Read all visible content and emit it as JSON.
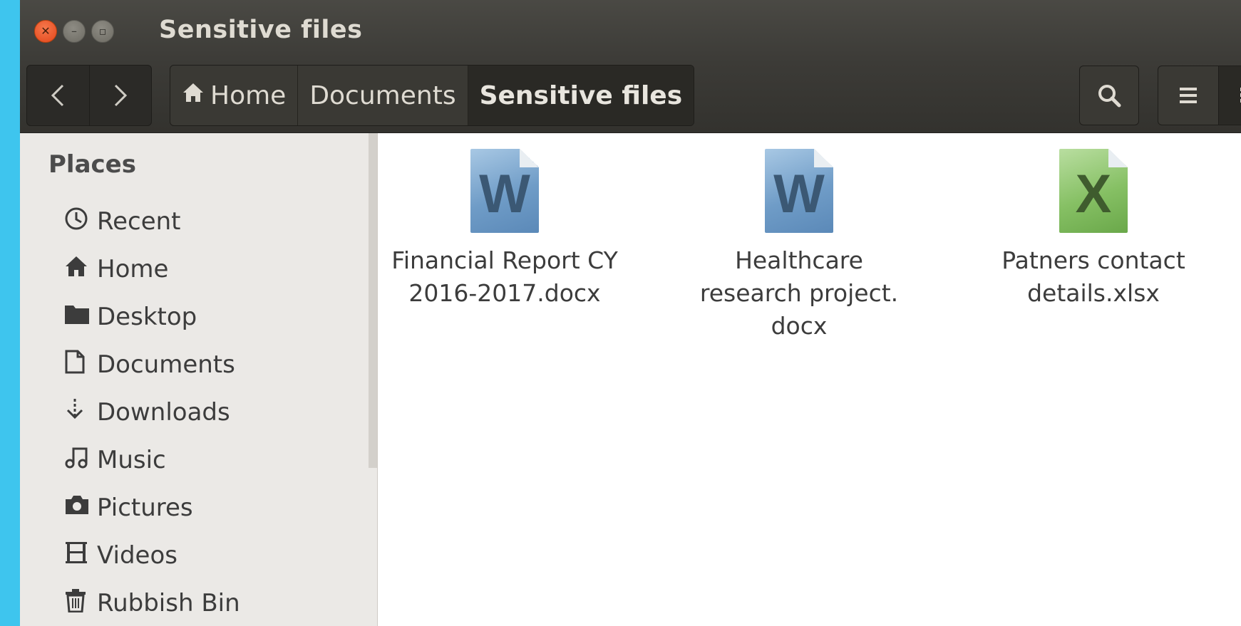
{
  "window": {
    "title": "Sensitive files"
  },
  "toolbar": {
    "back_icon": "chevron-left-icon",
    "forward_icon": "chevron-right-icon",
    "breadcrumb": [
      "Home",
      "Documents",
      "Sensitive files"
    ],
    "search_icon": "search-icon",
    "list_view_icon": "list-view-icon",
    "grid_view_icon": "grid-view-icon"
  },
  "sidebar": {
    "heading": "Places",
    "items": [
      {
        "label": "Recent",
        "icon": "clock-icon"
      },
      {
        "label": "Home",
        "icon": "home-icon"
      },
      {
        "label": "Desktop",
        "icon": "folder-icon"
      },
      {
        "label": "Documents",
        "icon": "document-icon"
      },
      {
        "label": "Downloads",
        "icon": "download-icon"
      },
      {
        "label": "Music",
        "icon": "music-icon"
      },
      {
        "label": "Pictures",
        "icon": "camera-icon"
      },
      {
        "label": "Videos",
        "icon": "film-icon"
      },
      {
        "label": "Rubbish Bin",
        "icon": "trash-icon"
      }
    ]
  },
  "files": [
    {
      "line1": "Financial Report CY",
      "line2": "2016-2017.docx",
      "line3": "",
      "icon": "word-document-icon",
      "letter": "W"
    },
    {
      "line1": "Healthcare",
      "line2": "research project.",
      "line3": "docx",
      "icon": "word-document-icon",
      "letter": "W"
    },
    {
      "line1": "Patners contact",
      "line2": "details.xlsx",
      "line3": "",
      "icon": "excel-spreadsheet-icon",
      "letter": "X"
    }
  ]
}
